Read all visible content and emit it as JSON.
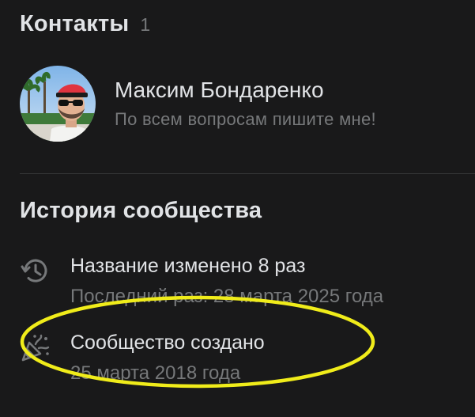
{
  "contacts": {
    "title": "Контакты",
    "count": "1",
    "items": [
      {
        "name": "Максим Бондаренко",
        "status": "По всем вопросам пишите мне!"
      }
    ]
  },
  "history": {
    "title": "История сообщества",
    "items": [
      {
        "icon": "history-icon",
        "main_prefix": "Название изменено",
        "main_value": "8 раз",
        "sub": "Последний раз: 28 марта 2025 года"
      },
      {
        "icon": "party-popper-icon",
        "main_prefix": "Сообщество создано",
        "main_value": "",
        "sub": "25 марта 2018 года"
      }
    ]
  },
  "annotation": {
    "color": "#f0ec1a"
  }
}
